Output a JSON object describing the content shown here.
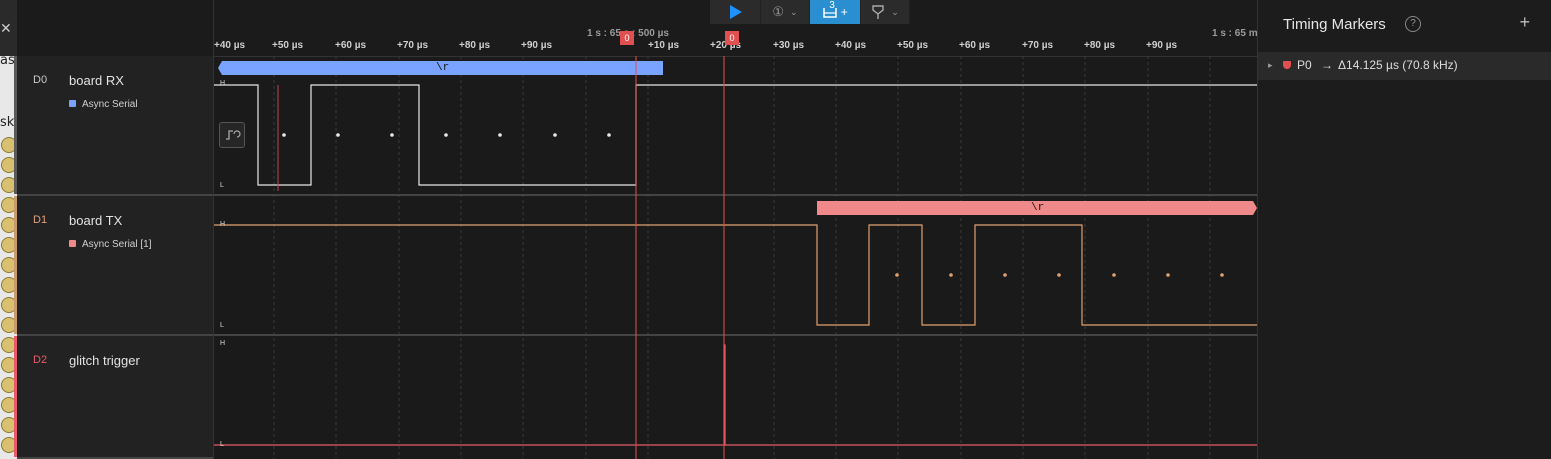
{
  "left_strip": {
    "close_glyph": "✕",
    "fragments": [
      "as",
      "sk"
    ]
  },
  "timeline": {
    "ticks": [
      "+40 µs",
      "+50 µs",
      "+60 µs",
      "+70 µs",
      "+80 µs",
      "+90 µs",
      "+10 µs",
      "+20 µs",
      "+30 µs",
      "+40 µs",
      "+50 µs",
      "+60 µs",
      "+70 µs",
      "+80 µs",
      "+90 µs"
    ],
    "abs_labels": [
      "1 s : 65 s : 500 µs",
      "1 s : 65 m"
    ]
  },
  "toolbar": {
    "play_icon": "play-icon",
    "trigger_label": "①",
    "markers_count": "3",
    "markers_add": "+"
  },
  "markers": {
    "flag_a": "0",
    "flag_b": "0"
  },
  "channels": [
    {
      "id": "D0",
      "name": "board RX",
      "analyzer": "Async Serial",
      "color": "#7aa2ff",
      "id_color": "#c8c8c8"
    },
    {
      "id": "D1",
      "name": "board TX",
      "analyzer": "Async Serial [1]",
      "color": "#f08a8a",
      "id_color": "#e0a080"
    },
    {
      "id": "D2",
      "name": "glitch trigger",
      "analyzer": "",
      "color": "#e85a6a",
      "id_color": "#e85a6a"
    }
  ],
  "decodes": {
    "rx": "\\r",
    "tx": "\\r"
  },
  "levels": {
    "high": "H",
    "low": "L"
  },
  "panel": {
    "title": "Timing Markers",
    "help": "?",
    "add": "+",
    "row": {
      "expand": "▸",
      "name": "P0",
      "arrow": "→",
      "value": "Δ14.125 µs (70.8 kHz)"
    }
  }
}
